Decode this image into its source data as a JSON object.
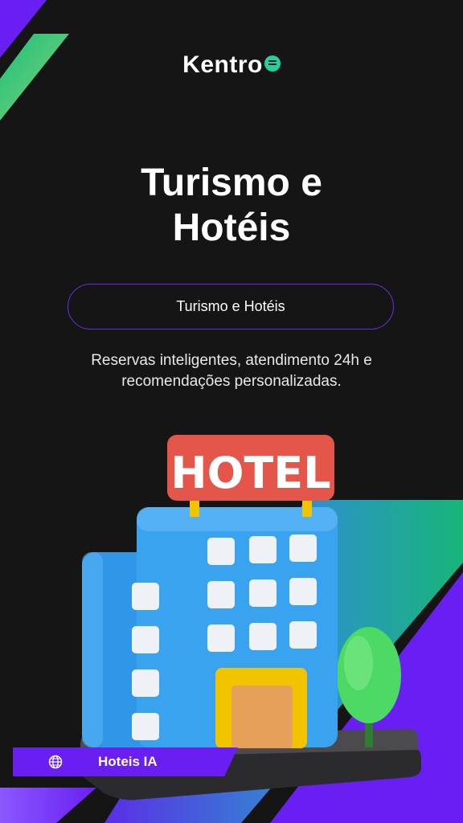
{
  "brand": {
    "logo_text": "Kentro"
  },
  "title": {
    "line1": "Turismo e",
    "line2": "Hotéis"
  },
  "pill": {
    "label": "Turismo e Hotéis"
  },
  "description": {
    "line1": "Reservas inteligentes, atendimento 24h e",
    "line2": "recomendações personalizadas."
  },
  "illustration": {
    "sign_text": "HOTEL"
  },
  "badge": {
    "icon": "globe-icon",
    "label": "Hoteis IA"
  },
  "colors": {
    "background": "#161516",
    "purple": "#6a1ff2",
    "green": "#1fbf7a",
    "building_blue": "#2f96e8",
    "sign_red": "#e4554a"
  }
}
